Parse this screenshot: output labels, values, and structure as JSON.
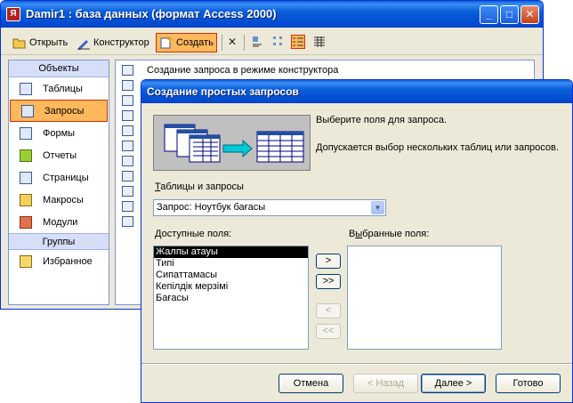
{
  "db_window": {
    "title": "Damir1 : база данных (формат Access 2000)",
    "app_icon_glyph": "Я",
    "caption": {
      "minimize": "_",
      "maximize": "□",
      "close": "✕"
    },
    "toolbar": {
      "open_label": "Открыть",
      "design_label": "Конструктор",
      "create_label": "Создать",
      "delete_glyph": "✕"
    },
    "objects_header": "Объекты",
    "objects": [
      "Таблицы",
      "Запросы",
      "Формы",
      "Отчеты",
      "Страницы",
      "Макросы",
      "Модули"
    ],
    "groups_header": "Группы",
    "groups": [
      "Избранное"
    ],
    "list_items": [
      "Создание запроса в режиме конструктора"
    ]
  },
  "dialog": {
    "title": "Создание простых запросов",
    "intro_line1": "Выберите поля для запроса.",
    "intro_line2": "Допускается выбор нескольких таблиц или запросов.",
    "tables_label": "Таблицы и запросы",
    "tables_label_underlined": "Т",
    "tables_label_rest": "аблицы и запросы",
    "combo_value": "Запрос: Ноутбук бағасы",
    "available_label_u": "Д",
    "available_label_rest": "оступные поля:",
    "selected_label_pre": "В",
    "selected_label_u": "ы",
    "selected_label_rest": "бранные поля:",
    "available_fields": [
      "Жалпы атауы",
      "Типі",
      "Сипаттамасы",
      "Кепілдік мерзімі",
      "Бағасы"
    ],
    "selected_fields": [],
    "move_buttons": {
      "one": ">",
      "all": ">>",
      "back_one": "<",
      "back_all": "<<"
    },
    "buttons": {
      "cancel": "Отмена",
      "back": "< Назад",
      "next": "Далее >",
      "finish": "Готово"
    },
    "colors": {
      "titlebar": "#0a5fd8",
      "selection": "#000000",
      "face": "#ece9d8"
    }
  }
}
